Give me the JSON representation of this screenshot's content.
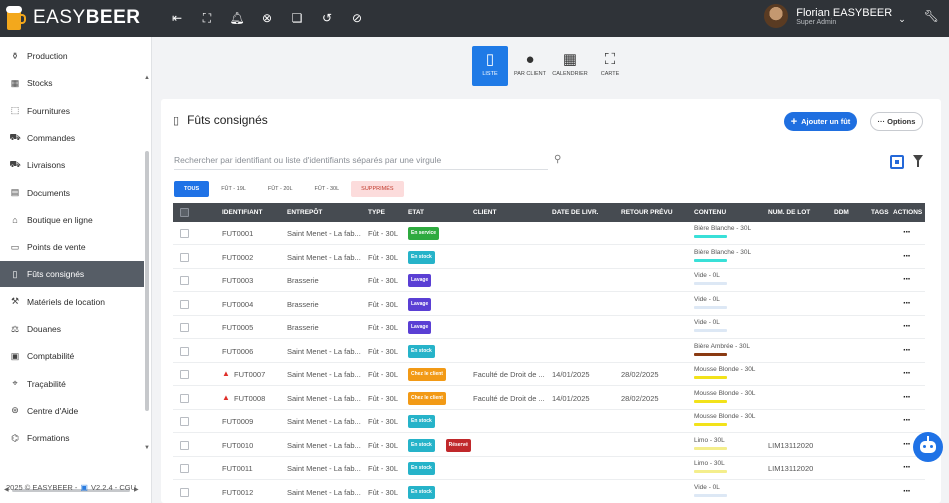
{
  "app": {
    "logo_light": "EASY",
    "logo_bold": "BEER"
  },
  "topbar": {
    "icons": [
      "collapse-menu-icon",
      "fullscreen-icon",
      "bell-icon",
      "close-circle-icon",
      "chat-icon",
      "history-icon",
      "tag-off-icon"
    ],
    "user_name": "Florian EASYBEER",
    "user_role": "Super Admin"
  },
  "sidebar": {
    "items": [
      {
        "label": "Production",
        "icon": "bottle-icon",
        "glyph": "⚱"
      },
      {
        "label": "Stocks",
        "icon": "warehouse-icon",
        "glyph": "▦"
      },
      {
        "label": "Fournitures",
        "icon": "box-icon",
        "glyph": "⬚"
      },
      {
        "label": "Commandes",
        "icon": "cart-icon",
        "glyph": "⛟"
      },
      {
        "label": "Livraisons",
        "icon": "truck-icon",
        "glyph": "⛟"
      },
      {
        "label": "Documents",
        "icon": "document-icon",
        "glyph": "▤"
      },
      {
        "label": "Boutique en ligne",
        "icon": "shop-icon",
        "glyph": "⌂"
      },
      {
        "label": "Points de vente",
        "icon": "store-icon",
        "glyph": "▭"
      },
      {
        "label": "Fûts consignés",
        "icon": "keg-icon",
        "glyph": "▯"
      },
      {
        "label": "Matériels de location",
        "icon": "equipment-icon",
        "glyph": "⚒"
      },
      {
        "label": "Douanes",
        "icon": "customs-icon",
        "glyph": "⚖"
      },
      {
        "label": "Comptabilité",
        "icon": "calculator-icon",
        "glyph": "▣"
      },
      {
        "label": "Traçabilité",
        "icon": "trace-icon",
        "glyph": "⌖"
      },
      {
        "label": "Centre d'Aide",
        "icon": "help-icon",
        "glyph": "⊛"
      },
      {
        "label": "Formations",
        "icon": "graduation-icon",
        "glyph": "⌬"
      }
    ],
    "active_index": 8,
    "footer_prefix": "2025 © EASYBEER -",
    "footer_version": "V2.2.4 - CGU"
  },
  "views": [
    {
      "label": "LISTE",
      "icon": "list-icon",
      "glyph": "▯",
      "active": true
    },
    {
      "label": "PAR CLIENT",
      "icon": "person-icon",
      "glyph": "●",
      "active": false
    },
    {
      "label": "CALENDRIER",
      "icon": "calendar-icon",
      "glyph": "▦",
      "active": false
    },
    {
      "label": "CARTE",
      "icon": "map-icon",
      "glyph": "⛶",
      "active": false
    }
  ],
  "page": {
    "title": "Fûts consignés",
    "add_button": "Ajouter un fût",
    "options_button": "··· Options",
    "search_placeholder": "Rechercher par identifiant ou liste d'identifiants séparés par une virgule"
  },
  "tabs": [
    {
      "label": "TOUS",
      "style": "active"
    },
    {
      "label": "FÛT - 19L",
      "style": ""
    },
    {
      "label": "FÛT - 20L",
      "style": ""
    },
    {
      "label": "FÛT - 30L",
      "style": ""
    },
    {
      "label": "SUPPRIMÉS",
      "style": "danger"
    }
  ],
  "table": {
    "headers": [
      "IDENTIFIANT",
      "ENTREPÔT",
      "TYPE",
      "ETAT",
      "CLIENT",
      "DATE DE LIVR.",
      "RETOUR PRÉVU",
      "CONTENU",
      "NUM. DE LOT",
      "DDM",
      "TAGS",
      "ACTIONS"
    ],
    "rows": [
      {
        "id": "FUT0001",
        "warn": false,
        "entrepot": "Saint Menet - La fab...",
        "type": "Fût - 30L",
        "etat": [
          {
            "label": "En service",
            "color": "#2eaa3f"
          }
        ],
        "client": "",
        "livr": "",
        "retour": "",
        "contenu": "Bière Blanche - 30L",
        "bar": "#39e0d8",
        "lot": ""
      },
      {
        "id": "FUT0002",
        "warn": false,
        "entrepot": "Saint Menet - La fab...",
        "type": "Fût - 30L",
        "etat": [
          {
            "label": "En stock",
            "color": "#26b3c9"
          }
        ],
        "client": "",
        "livr": "",
        "retour": "",
        "contenu": "Bière Blanche - 30L",
        "bar": "#39e0d8",
        "lot": ""
      },
      {
        "id": "FUT0003",
        "warn": false,
        "entrepot": "Brasserie",
        "type": "Fût - 30L",
        "etat": [
          {
            "label": "Lavage",
            "color": "#5a3fd4"
          }
        ],
        "client": "",
        "livr": "",
        "retour": "",
        "contenu": "Vide - 0L",
        "bar": "#dde8f5",
        "lot": ""
      },
      {
        "id": "FUT0004",
        "warn": false,
        "entrepot": "Brasserie",
        "type": "Fût - 30L",
        "etat": [
          {
            "label": "Lavage",
            "color": "#5a3fd4"
          }
        ],
        "client": "",
        "livr": "",
        "retour": "",
        "contenu": "Vide - 0L",
        "bar": "#dde8f5",
        "lot": ""
      },
      {
        "id": "FUT0005",
        "warn": false,
        "entrepot": "Brasserie",
        "type": "Fût - 30L",
        "etat": [
          {
            "label": "Lavage",
            "color": "#5a3fd4"
          }
        ],
        "client": "",
        "livr": "",
        "retour": "",
        "contenu": "Vide - 0L",
        "bar": "#dde8f5",
        "lot": ""
      },
      {
        "id": "FUT0006",
        "warn": false,
        "entrepot": "Saint Menet - La fab...",
        "type": "Fût - 30L",
        "etat": [
          {
            "label": "En stock",
            "color": "#26b3c9"
          }
        ],
        "client": "",
        "livr": "",
        "retour": "",
        "contenu": "Bière Ambrée - 30L",
        "bar": "#8a3a12",
        "lot": ""
      },
      {
        "id": "FUT0007",
        "warn": true,
        "entrepot": "Saint Menet - La fab...",
        "type": "Fût - 30L",
        "etat": [
          {
            "label": "Chez le client",
            "color": "#f29a16"
          }
        ],
        "client": "Faculté de Droit de ...",
        "livr": "14/01/2025",
        "retour": "28/02/2025",
        "contenu": "Mousse Blonde - 30L",
        "bar": "#f2e21a",
        "lot": ""
      },
      {
        "id": "FUT0008",
        "warn": true,
        "entrepot": "Saint Menet - La fab...",
        "type": "Fût - 30L",
        "etat": [
          {
            "label": "Chez le client",
            "color": "#f29a16"
          }
        ],
        "client": "Faculté de Droit de ...",
        "livr": "14/01/2025",
        "retour": "28/02/2025",
        "contenu": "Mousse Blonde - 30L",
        "bar": "#f2e21a",
        "lot": ""
      },
      {
        "id": "FUT0009",
        "warn": false,
        "entrepot": "Saint Menet - La fab...",
        "type": "Fût - 30L",
        "etat": [
          {
            "label": "En stock",
            "color": "#26b3c9"
          }
        ],
        "client": "",
        "livr": "",
        "retour": "",
        "contenu": "Mousse Blonde - 30L",
        "bar": "#f2e21a",
        "lot": ""
      },
      {
        "id": "FUT0010",
        "warn": false,
        "entrepot": "Saint Menet - La fab...",
        "type": "Fût - 30L",
        "etat": [
          {
            "label": "En stock",
            "color": "#26b3c9"
          },
          {
            "label": "Réservé",
            "color": "#c0282b"
          }
        ],
        "client": "",
        "livr": "",
        "retour": "",
        "contenu": "Limo - 30L",
        "bar": "#f4ee8c",
        "lot": "LIM13112020"
      },
      {
        "id": "FUT0011",
        "warn": false,
        "entrepot": "Saint Menet - La fab...",
        "type": "Fût - 30L",
        "etat": [
          {
            "label": "En stock",
            "color": "#26b3c9"
          }
        ],
        "client": "",
        "livr": "",
        "retour": "",
        "contenu": "Limo - 30L",
        "bar": "#f4ee8c",
        "lot": "LIM13112020"
      },
      {
        "id": "FUT0012",
        "warn": false,
        "entrepot": "Saint Menet - La fab...",
        "type": "Fût - 30L",
        "etat": [
          {
            "label": "En stock",
            "color": "#26b3c9"
          }
        ],
        "client": "",
        "livr": "",
        "retour": "",
        "contenu": "Vide - 0L",
        "bar": "#dde8f5",
        "lot": ""
      }
    ]
  }
}
